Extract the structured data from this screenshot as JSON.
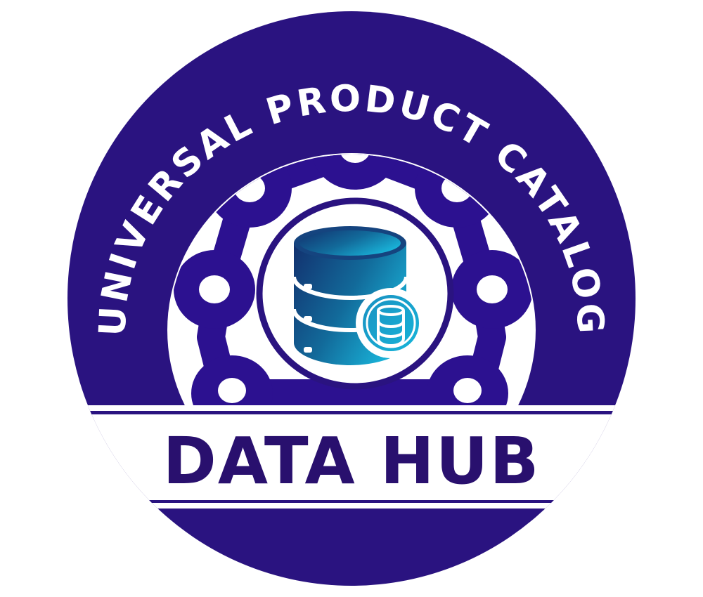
{
  "badge": {
    "arc_title": "UNIVERSAL PRODUCT CATALOG",
    "band_title": "DATA HUB",
    "icon": "database-icon",
    "sub_icon": "small-database-icon",
    "chain_icon": "chain-ring-icon",
    "colors": {
      "primary": "#29106e",
      "ring": "#2a1380",
      "white": "#ffffff",
      "icon_dark": "#12306e",
      "icon_light": "#18a9d3"
    }
  }
}
